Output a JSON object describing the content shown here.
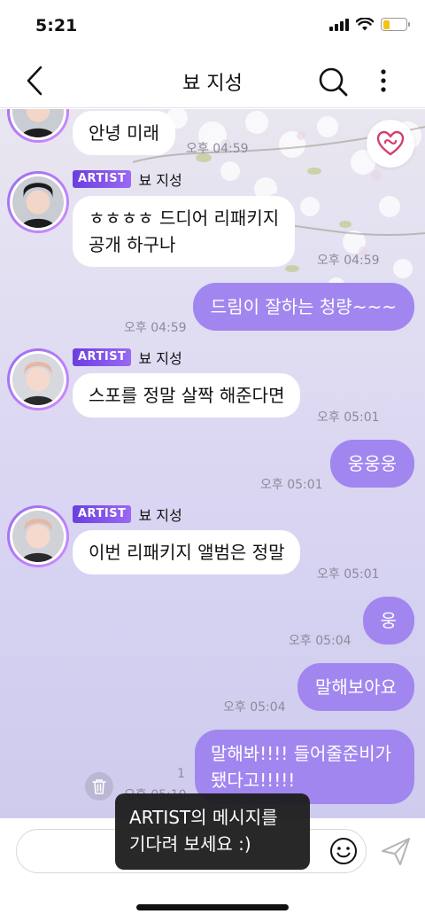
{
  "status_bar": {
    "time": "5:21"
  },
  "header": {
    "title": "뵤 지성"
  },
  "messages": [
    {
      "text": "안녕 미래",
      "time": "오후 04:59"
    },
    {
      "sender": "뵤 지성",
      "badge": "ARTIST",
      "text": "ㅎㅎㅎㅎ 드디어 리패키지\n공개 하구나",
      "time": "오후 04:59"
    },
    {
      "text": "드림이 잘하는 청량~~~",
      "time": "오후 04:59"
    },
    {
      "sender": "뵤 지성",
      "badge": "ARTIST",
      "text": "스포를 정말 살짝 해준다면",
      "time": "오후 05:01"
    },
    {
      "text": "웅웅웅",
      "time": "오후 05:01"
    },
    {
      "sender": "뵤 지성",
      "badge": "ARTIST",
      "text": "이번 리패키지 앨범은 정말",
      "time": "오후 05:01"
    },
    {
      "text": "웅",
      "time": "오후 05:04"
    },
    {
      "text": "말해보아요",
      "time": "오후 05:04"
    },
    {
      "text": "말해봐!!!! 들어줄준비가\n됐다고!!!!!",
      "time": "오후 05:10",
      "unread": "1"
    }
  ],
  "toast": {
    "text": "ARTIST의 메시지를\n기다려 보세요 :)"
  },
  "colors": {
    "accent": "#a186f0",
    "badge": "#6a3fe0",
    "heart": "#d43f6d"
  },
  "icons": [
    "back-arrow-icon",
    "search-icon",
    "more-vertical-icon",
    "heart-icon",
    "trash-icon",
    "emoji-icon",
    "send-icon"
  ]
}
